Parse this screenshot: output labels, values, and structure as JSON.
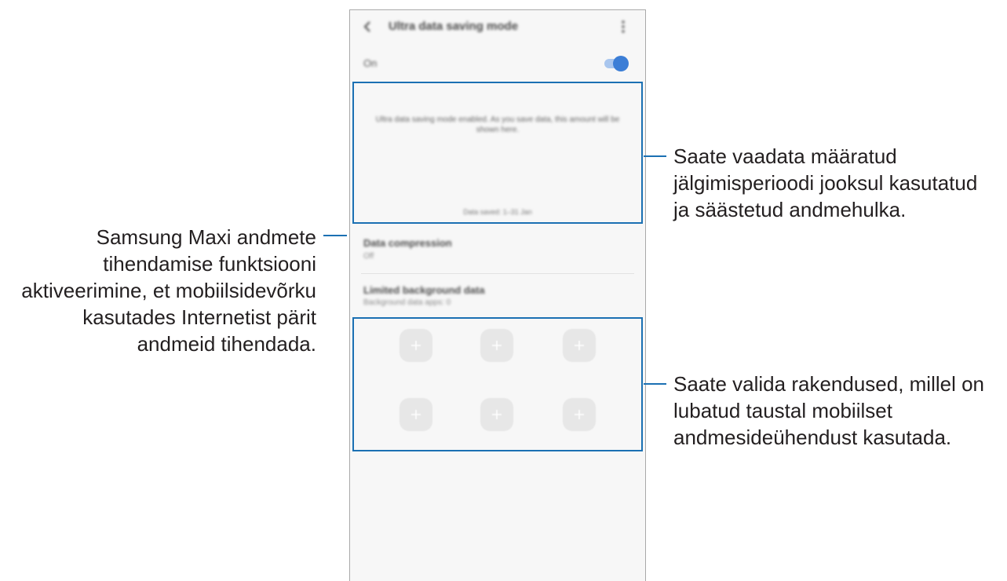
{
  "phone": {
    "header": {
      "title": "Ultra data saving mode",
      "back_icon": "chevron-left-icon",
      "menu_icon": "more-vertical-icon"
    },
    "master_switch": {
      "label": "On",
      "state": true
    },
    "summary": {
      "message": "Ultra data saving mode enabled. As you save data, this amount will be shown here.",
      "period": "Data saved: 1–31 Jan"
    },
    "data_compression": {
      "title": "Data compression",
      "status": "Off"
    },
    "limited_background": {
      "title": "Limited background data",
      "subtitle": "Background data apps: 0"
    },
    "app_slots": [
      {
        "icon": "plus-icon"
      },
      {
        "icon": "plus-icon"
      },
      {
        "icon": "plus-icon"
      },
      {
        "icon": "plus-icon"
      },
      {
        "icon": "plus-icon"
      },
      {
        "icon": "plus-icon"
      }
    ]
  },
  "callouts": {
    "summary": {
      "lines": [
        "Saate vaadata määratud",
        "jälgimisperioodi jooksul kasutatud",
        "ja säästetud andmehulka."
      ]
    },
    "compression": {
      "lines": [
        "Samsung Maxi andmete",
        "tihendamise funktsiooni",
        "aktiveerimine, et mobiilsidevõrku",
        "kasutades Internetist pärit",
        "andmeid tihendada."
      ]
    },
    "apps": {
      "lines": [
        "Saate valida rakendused, millel on",
        "lubatud taustal mobiilset",
        "andmesideühendust kasutada."
      ]
    }
  },
  "colors": {
    "callout_blue": "#1b70b3",
    "switch_on": "#3c7ed6",
    "text": "#231f20"
  }
}
